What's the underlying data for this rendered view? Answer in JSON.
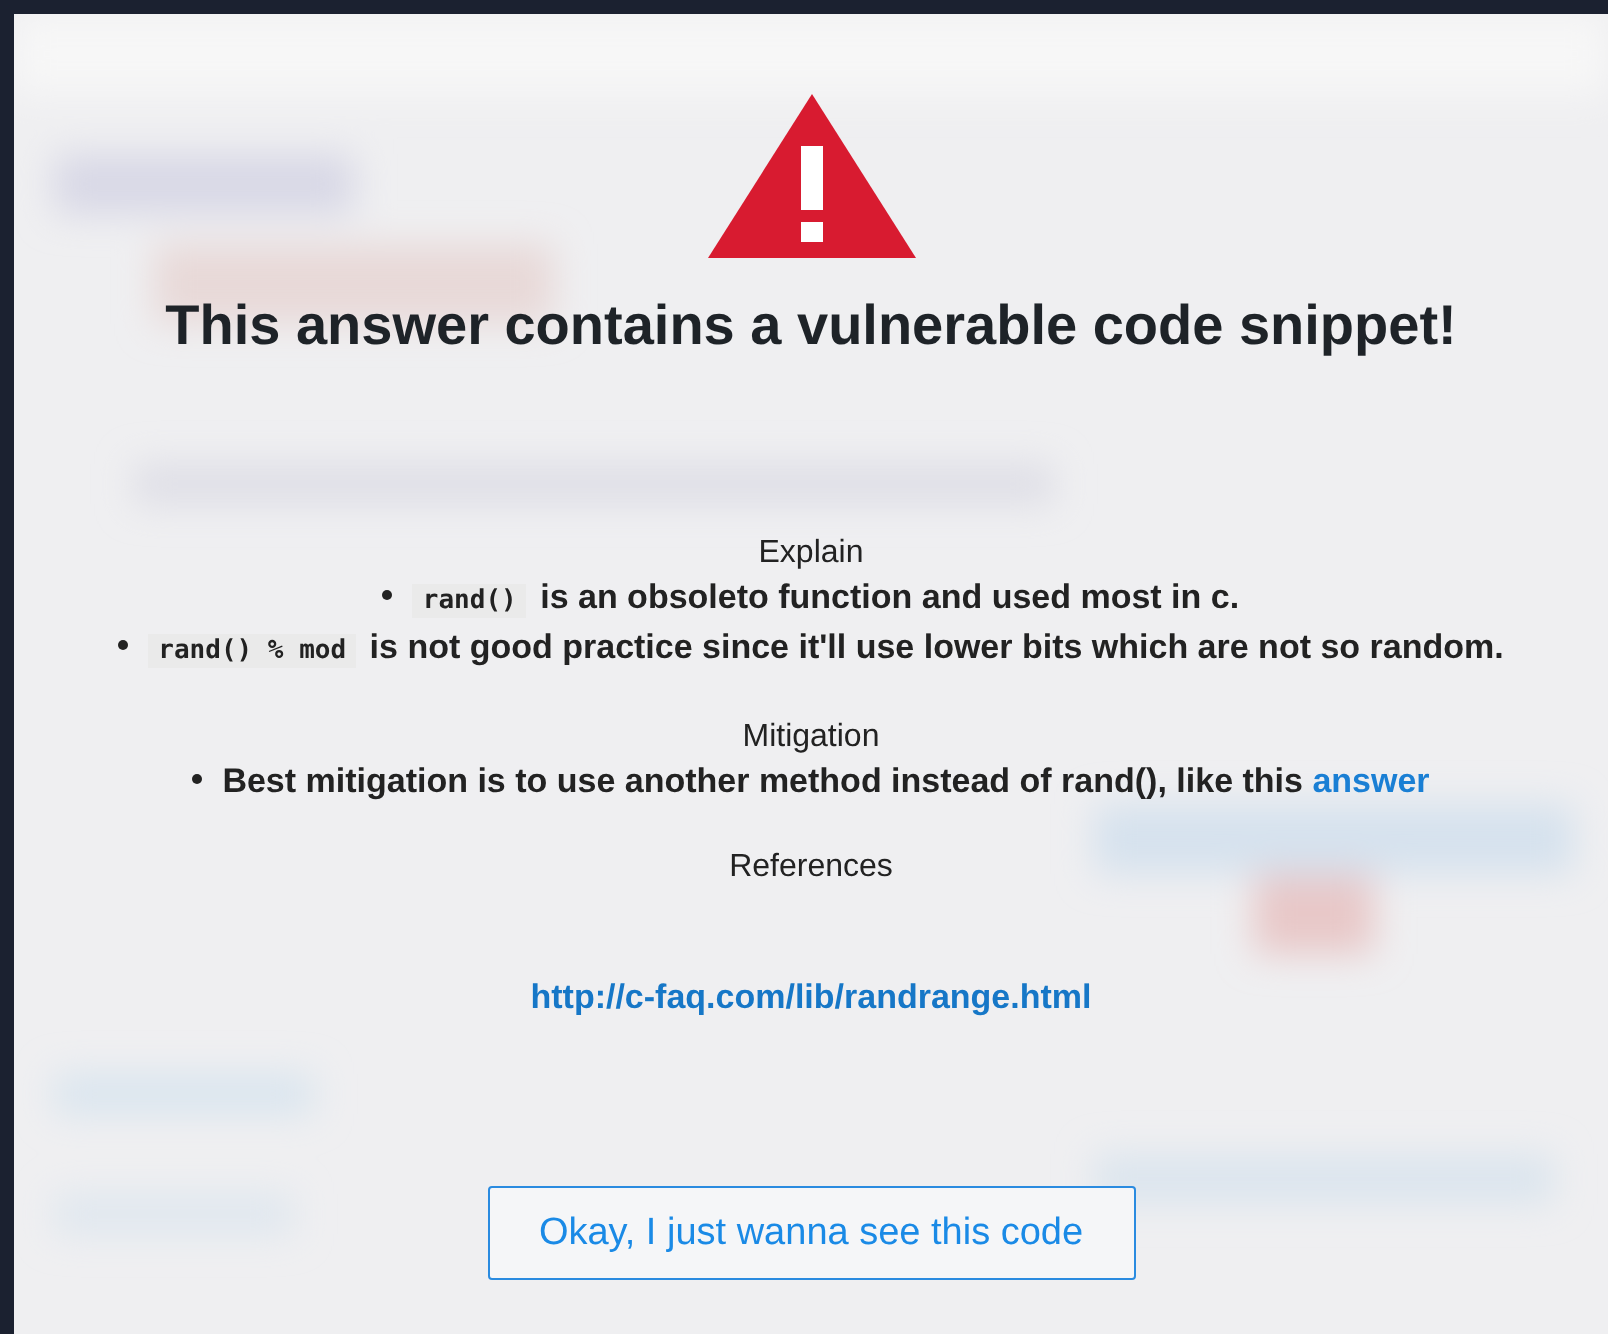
{
  "warning": {
    "title": "This answer contains a vulnerable code snippet!"
  },
  "sections": [
    {
      "heading": "Explain",
      "items": [
        {
          "code": "rand()",
          "text": "is an obsoleto function and used most in c."
        },
        {
          "code": "rand() % mod",
          "text": "is not good practice since it'll use lower bits which are not so random."
        }
      ]
    },
    {
      "heading": "Mitigation",
      "items": [
        {
          "text": "Best mitigation is to use another method instead of rand(), like this",
          "link": "answer"
        }
      ]
    },
    {
      "heading": "References",
      "links": [
        "http://c-faq.com/lib/randrange.html"
      ]
    }
  ],
  "button": {
    "label": "Okay, I just wanna see this code"
  }
}
